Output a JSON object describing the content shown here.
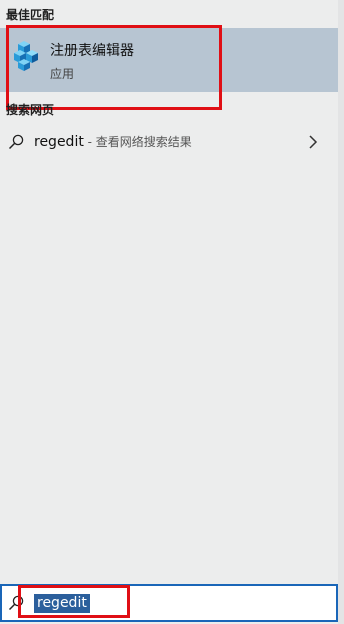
{
  "best_match": {
    "heading": "最佳匹配",
    "app_name": "注册表编辑器",
    "app_type": "应用",
    "icon": "registry-editor-icon"
  },
  "web": {
    "heading": "搜索网页",
    "query": "regedit",
    "suffix": " - 查看网络搜索结果",
    "chevron_icon": "chevron-right-icon"
  },
  "search": {
    "value": "regedit",
    "icon": "search-icon"
  },
  "colors": {
    "highlight_row": "#b7c5d2",
    "annotation_red": "#e00f15",
    "search_border": "#1a66b8",
    "selection": "#2b5f9c"
  }
}
